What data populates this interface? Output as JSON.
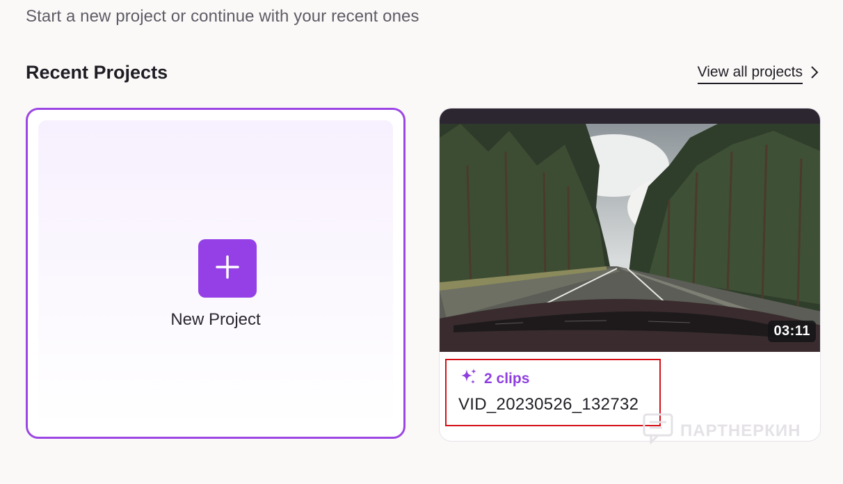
{
  "header": {
    "subtitle": "Start a new project or continue with your recent ones"
  },
  "recent": {
    "title": "Recent Projects",
    "view_all_label": "View all projects"
  },
  "new_project": {
    "label": "New Project"
  },
  "projects": [
    {
      "duration": "03:11",
      "clips_label": "2 clips",
      "name": "VID_20230526_132732"
    }
  ],
  "watermark": {
    "text": "ПАРТНЕРКИН"
  },
  "colors": {
    "accent": "#9440e6",
    "highlight": "#d40f16"
  }
}
